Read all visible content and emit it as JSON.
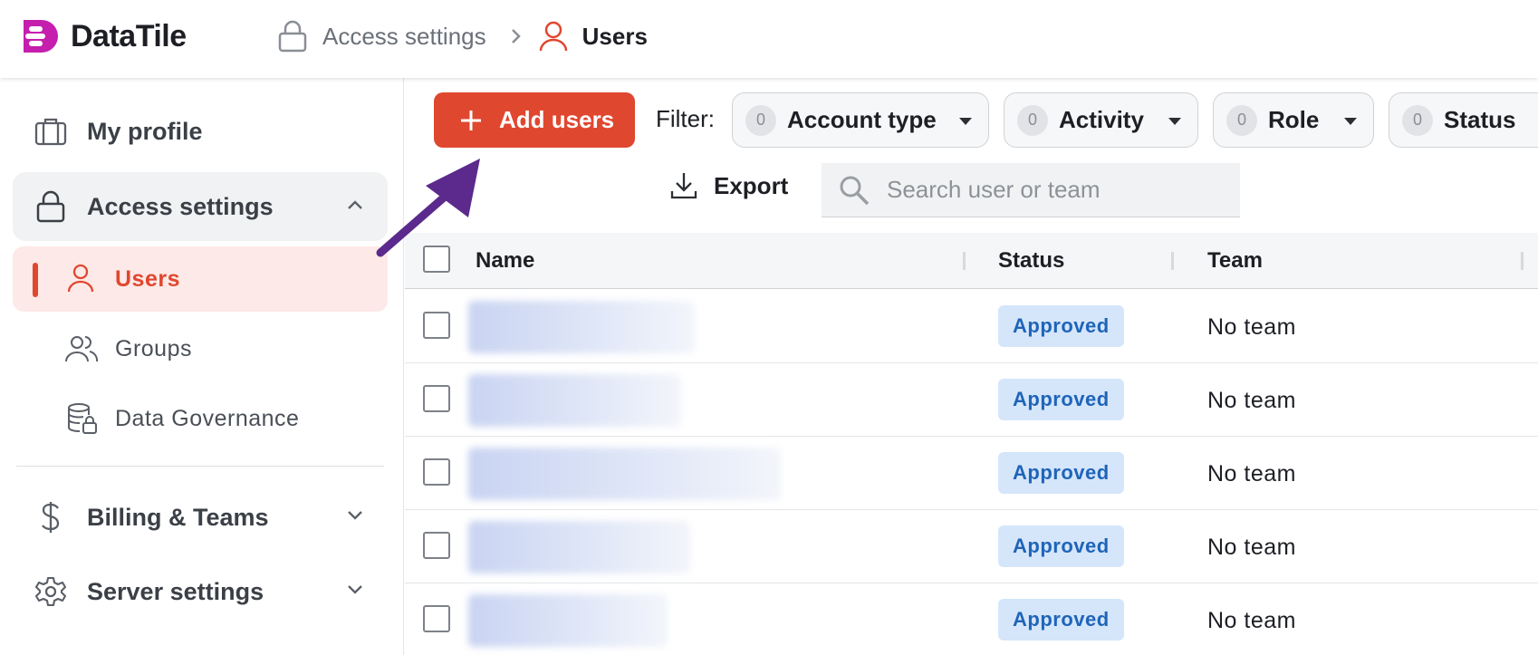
{
  "app": {
    "name": "DataTile"
  },
  "breadcrumb": {
    "parent": "Access settings",
    "current": "Users"
  },
  "sidebar": {
    "my_profile": "My profile",
    "access_settings": "Access settings",
    "users": "Users",
    "groups": "Groups",
    "data_governance": "Data Governance",
    "billing_teams": "Billing & Teams",
    "server_settings": "Server settings"
  },
  "toolbar": {
    "add_users": "Add users",
    "filter_label": "Filter:",
    "filters": [
      {
        "label": "Account type",
        "count": "0"
      },
      {
        "label": "Activity",
        "count": "0"
      },
      {
        "label": "Role",
        "count": "0"
      },
      {
        "label": "Status",
        "count": "0"
      }
    ],
    "export": "Export",
    "search_placeholder": "Search user or team"
  },
  "table": {
    "columns": {
      "name": "Name",
      "status": "Status",
      "team": "Team"
    },
    "rows": [
      {
        "status": "Approved",
        "team": "No team"
      },
      {
        "status": "Approved",
        "team": "No team"
      },
      {
        "status": "Approved",
        "team": "No team"
      },
      {
        "status": "Approved",
        "team": "No team"
      },
      {
        "status": "Approved",
        "team": "No team"
      }
    ]
  },
  "colors": {
    "accent": "#e0472f",
    "active_bg": "#fde9e7",
    "badge_bg": "#d5e6fb",
    "badge_text": "#1f64b8",
    "annotation_arrow": "#5b2a8c"
  }
}
